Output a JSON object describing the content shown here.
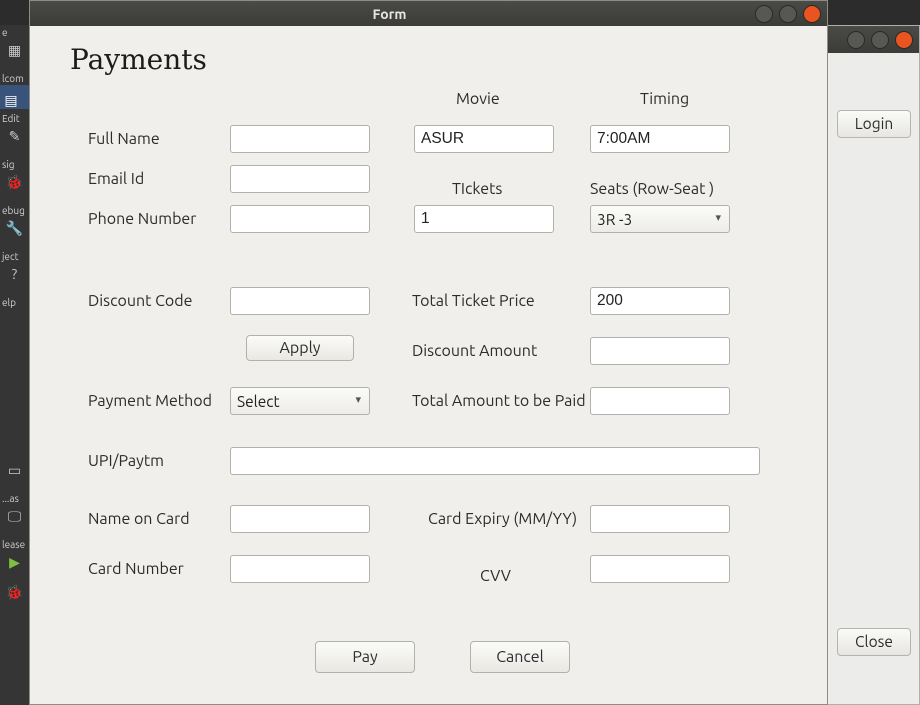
{
  "launcher": {
    "items": [
      "e",
      "lcom",
      "Edit",
      "sig",
      "ebug",
      "ject",
      "elp",
      "...as",
      "lease"
    ]
  },
  "secondary_window": {
    "login": "Login",
    "close": "Close"
  },
  "dialog": {
    "window_title": "Form",
    "page_title": "Payments",
    "labels": {
      "full_name": "Full Name",
      "email": "Email Id",
      "phone": "Phone Number",
      "discount_code": "Discount Code",
      "apply": "Apply",
      "payment_method": "Payment Method",
      "upi": "UPI/Paytm",
      "name_on_card": "Name on Card",
      "card_number": "Card Number",
      "movie": "Movie",
      "timing": "Timing",
      "tickets": "TIckets",
      "seats": "Seats (Row-Seat )",
      "total_ticket_price": "Total Ticket Price",
      "discount_amount": "Discount Amount",
      "total_amount": "Total Amount to be Paid",
      "card_expiry": "Card Expiry (MM/YY)",
      "cvv": "CVV",
      "pay": "Pay",
      "cancel": "Cancel"
    },
    "values": {
      "full_name": "",
      "email": "",
      "phone": "",
      "discount_code": "",
      "payment_method": "Select",
      "upi": "",
      "name_on_card": "",
      "card_number": "",
      "movie": "ASUR",
      "timing": "7:00AM",
      "tickets": "1",
      "seats": "3R -3",
      "total_ticket_price": "200",
      "discount_amount": "",
      "total_amount": "",
      "card_expiry": "",
      "cvv": ""
    }
  }
}
